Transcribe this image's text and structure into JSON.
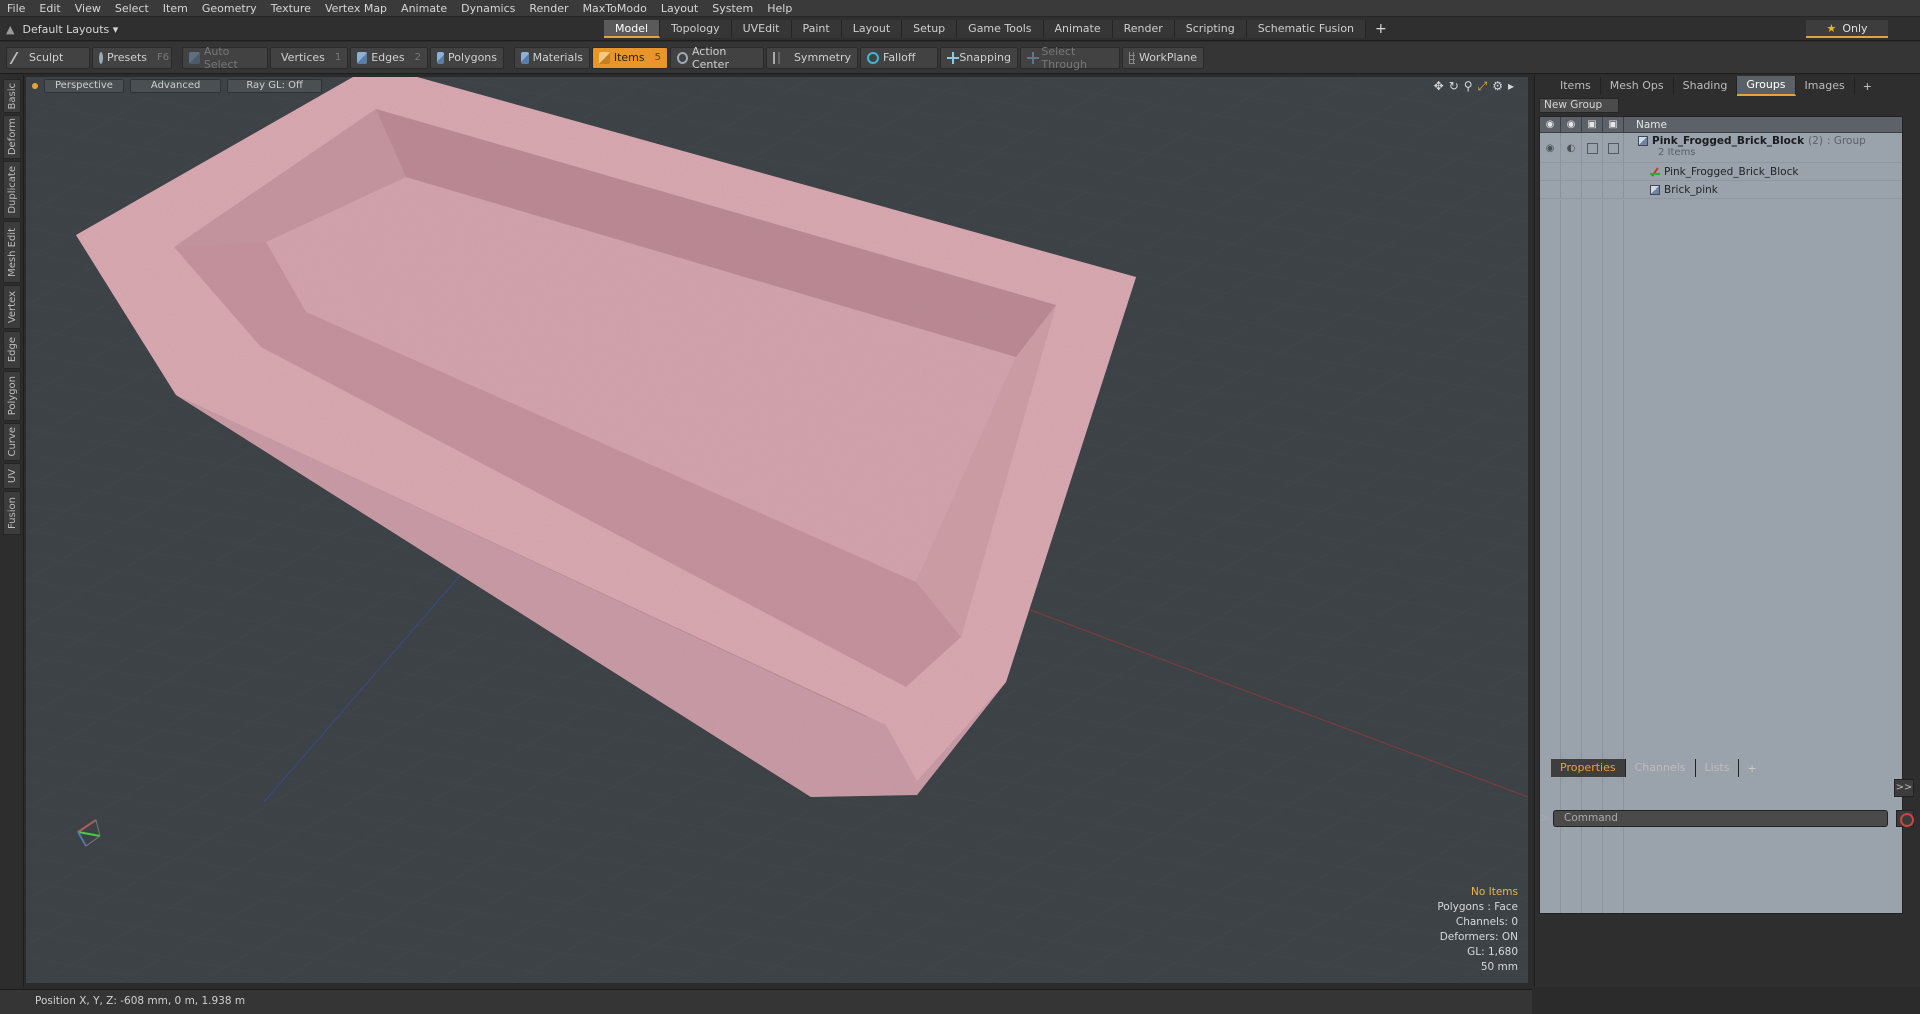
{
  "menu": [
    "File",
    "Edit",
    "View",
    "Select",
    "Item",
    "Geometry",
    "Texture",
    "Vertex Map",
    "Animate",
    "Dynamics",
    "Render",
    "MaxToModo",
    "Layout",
    "System",
    "Help"
  ],
  "layouts": {
    "label": "Default Layouts ▾"
  },
  "layout_tabs": [
    {
      "label": "Model",
      "active": true
    },
    {
      "label": "Topology"
    },
    {
      "label": "UVEdit"
    },
    {
      "label": "Paint"
    },
    {
      "label": "Layout"
    },
    {
      "label": "Setup"
    },
    {
      "label": "Game Tools"
    },
    {
      "label": "Animate"
    },
    {
      "label": "Render"
    },
    {
      "label": "Scripting"
    },
    {
      "label": "Schematic Fusion"
    }
  ],
  "layout_tabs_plus": "+",
  "only_button": {
    "label": "Only",
    "star": "★"
  },
  "toolbar": {
    "sculpt": "Sculpt",
    "presets": "Presets",
    "presets_key": "F6",
    "auto_select": "Auto Select",
    "vertices": "Vertices",
    "vertices_key": "1",
    "edges": "Edges",
    "edges_key": "2",
    "polygons": "Polygons",
    "materials": "Materials",
    "items": "Items",
    "items_key": "5",
    "action_center": "Action Center",
    "symmetry": "Symmetry",
    "falloff": "Falloff",
    "snapping": "Snapping",
    "select_through": "Select Through",
    "workplane": "WorkPlane"
  },
  "left_tabs": [
    "Basic",
    "Deform",
    "Duplicate",
    "Mesh Edit",
    "Vertex",
    "Edge",
    "Polygon",
    "Curve",
    "UV",
    "Fusion"
  ],
  "viewport": {
    "view": "Perspective",
    "shading": "Advanced",
    "raygl": "Ray GL: Off",
    "info": {
      "items": "No Items",
      "polygons": "Polygons : Face",
      "channels": "Channels: 0",
      "deformers": "Deformers: ON",
      "gl": "GL: 1,680",
      "scale": "50 mm"
    }
  },
  "right_panel": {
    "tabs": [
      {
        "label": "Items"
      },
      {
        "label": "Mesh Ops"
      },
      {
        "label": "Shading"
      },
      {
        "label": "Groups",
        "active": true
      },
      {
        "label": "Images"
      }
    ],
    "tabs_plus": "+",
    "new_group": "New Group",
    "column_name": "Name",
    "group": {
      "name": "Pink_Frogged_Brick_Block",
      "count": "(2)",
      "type": ": Group",
      "sub": "2 Items",
      "children": [
        "Pink_Frogged_Brick_Block",
        "Brick_pink"
      ]
    },
    "bottom_tabs": [
      {
        "label": "Properties",
        "active": true
      },
      {
        "label": "Channels"
      },
      {
        "label": "Lists"
      }
    ],
    "bottom_plus": "+",
    "expand": ">>",
    "command_placeholder": "Command",
    "command_arrow": ">"
  },
  "status": {
    "position": "Position X, Y, Z:  -608 mm, 0 m, 1.938 m"
  },
  "colors": {
    "accent": "#e8a23a",
    "brick": "#d8a7b1",
    "viewport_bg": "#3c4246"
  }
}
